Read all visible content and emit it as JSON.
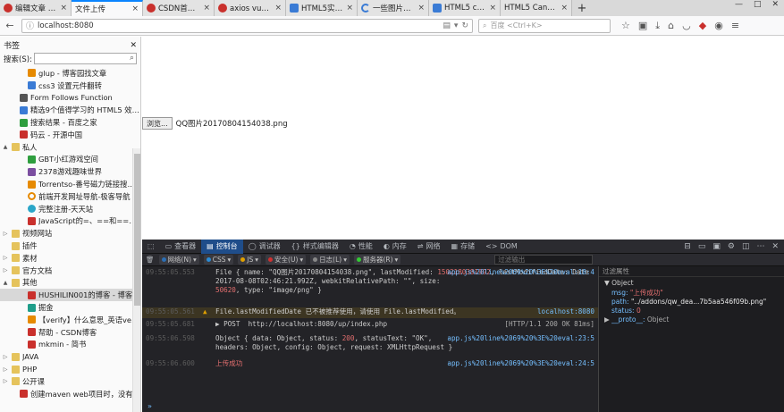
{
  "tabs": [
    {
      "label": "编辑文章 - CSD",
      "icon": "csdn-icon",
      "active": false
    },
    {
      "label": "文件上传",
      "icon": "none",
      "active": true
    },
    {
      "label": "CSDN首页-全球",
      "icon": "csdn-icon",
      "active": false
    },
    {
      "label": "axios vue 跨域",
      "icon": "csdn-icon",
      "active": false
    },
    {
      "label": "HTML5实战—",
      "icon": "page-icon",
      "active": false
    },
    {
      "label": "一些图片尺寸和",
      "icon": "loading-icon",
      "active": false
    },
    {
      "label": "HTML5 canvas",
      "icon": "page-icon",
      "active": false
    },
    {
      "label": "HTML5 Canvas",
      "icon": "none",
      "active": false
    }
  ],
  "window_controls": {
    "min": "—",
    "max": "□",
    "close": "✕"
  },
  "nav": {
    "url": "localhost:8080",
    "search_placeholder": "百度 <Ctrl+K>"
  },
  "sidebar": {
    "title": "书签",
    "search_label": "搜索(S):",
    "items": [
      {
        "label": "glup - 博客园找文章",
        "icon": "orange",
        "indent": 2,
        "twisty": ""
      },
      {
        "label": "css3 设置元件翻转",
        "icon": "blue",
        "indent": 2,
        "twisty": ""
      },
      {
        "label": "Form Follows Function",
        "icon": "dark",
        "indent": 1,
        "twisty": ""
      },
      {
        "label": "精选9个值得学习的 HTML5 效果...",
        "icon": "blue",
        "indent": 1,
        "twisty": ""
      },
      {
        "label": "搜索结果 - 百度之家",
        "icon": "green",
        "indent": 1,
        "twisty": ""
      },
      {
        "label": "码云 - 开源中国",
        "icon": "red",
        "indent": 1,
        "twisty": ""
      },
      {
        "label": "私人",
        "icon": "folder",
        "indent": 0,
        "twisty": "▲"
      },
      {
        "label": "GBT小红游戏空间",
        "icon": "green",
        "indent": 2,
        "twisty": ""
      },
      {
        "label": "2378游戏趣味世界",
        "icon": "purple",
        "indent": 2,
        "twisty": ""
      },
      {
        "label": "Torrentso-番号磁力链接搜索...",
        "icon": "orange",
        "indent": 2,
        "twisty": ""
      },
      {
        "label": "前端开发网址导航-极客导航",
        "icon": "ring",
        "indent": 2,
        "twisty": ""
      },
      {
        "label": "完整注册-天天站",
        "icon": "cyan",
        "indent": 2,
        "twisty": ""
      },
      {
        "label": "JavaScript的=、==和=== - ...",
        "icon": "red",
        "indent": 2,
        "twisty": ""
      },
      {
        "label": "视频网站",
        "icon": "folder",
        "indent": 0,
        "twisty": "▷"
      },
      {
        "label": "插件",
        "icon": "folder",
        "indent": 0,
        "twisty": ""
      },
      {
        "label": "素材",
        "icon": "folder",
        "indent": 0,
        "twisty": "▷"
      },
      {
        "label": "官方文档",
        "icon": "folder",
        "indent": 0,
        "twisty": "▷"
      },
      {
        "label": "其他",
        "icon": "folder",
        "indent": 0,
        "twisty": "▲"
      },
      {
        "label": "HUSHILIN001的博客 - 博客频...",
        "icon": "red",
        "indent": 2,
        "twisty": "",
        "selected": true
      },
      {
        "label": "掘金",
        "icon": "teal",
        "indent": 2,
        "twisty": ""
      },
      {
        "label": "【verify】什么意思_英语verify...",
        "icon": "orange",
        "indent": 2,
        "twisty": ""
      },
      {
        "label": "帮助 - CSDN博客",
        "icon": "red",
        "indent": 2,
        "twisty": ""
      },
      {
        "label": "mkmin - 简书",
        "icon": "red",
        "indent": 2,
        "twisty": ""
      },
      {
        "label": "JAVA",
        "icon": "folder",
        "indent": 0,
        "twisty": "▷"
      },
      {
        "label": "PHP",
        "icon": "folder",
        "indent": 0,
        "twisty": "▷"
      },
      {
        "label": "公开课",
        "icon": "folder",
        "indent": 0,
        "twisty": "▷"
      },
      {
        "label": "创建maven web项目时，没有we...",
        "icon": "red",
        "indent": 1,
        "twisty": ""
      }
    ]
  },
  "page": {
    "browse_label": "浏览...",
    "file_name": "QQ图片20170804154038.png"
  },
  "devtools": {
    "tabs": [
      {
        "label": "查看器",
        "icon": "inspector-icon"
      },
      {
        "label": "控制台",
        "icon": "console-icon",
        "active": true
      },
      {
        "label": "调试器",
        "icon": "debugger-icon"
      },
      {
        "label": "样式编辑器",
        "icon": "style-editor-icon"
      },
      {
        "label": "性能",
        "icon": "performance-icon"
      },
      {
        "label": "内存",
        "icon": "memory-icon"
      },
      {
        "label": "网络",
        "icon": "network-icon"
      },
      {
        "label": "存储",
        "icon": "storage-icon"
      },
      {
        "label": "DOM",
        "icon": "dom-icon"
      }
    ],
    "filters": [
      {
        "label": "网络(N)",
        "color": "#2b6fb5"
      },
      {
        "label": "CSS",
        "color": "#2b8cd6"
      },
      {
        "label": "JS",
        "color": "#e0a000"
      },
      {
        "label": "安全(U)",
        "color": "#d03030"
      },
      {
        "label": "日志(L)",
        "color": "#888"
      },
      {
        "label": "服务器(R)",
        "color": "#3c3"
      }
    ],
    "filter_placeholder": "过滤输出",
    "vars_placeholder": "过滤属性",
    "logs": {
      "l1_ts": "09:55:05.553",
      "l1_a": "File { name: \"QQ图片20170804154038.png\", lastModified: ",
      "l1_b": "1502180381992",
      "l1_c": ", lastModifiedDate: Date",
      "l1_d": "2017-08-08T02:46:21.992Z, webkitRelativePath: \"\", size:",
      "l1_e": "50620",
      "l1_f": ", type: \"image/png\" }",
      "l1_src": "app.js%20line%2069%20%3E%20eval:18:4",
      "l2_ts": "09:55:05.561",
      "l2_msg": "File.lastModifiedDate 已不被推荐使用，请使用 File.lastModified。",
      "l2_src": "localhost:8080",
      "l3_ts": "09:55:05.681",
      "l3_msg": "▶ POST  http://localhost:8080/up/index.php",
      "l3_src": "[HTTP/1.1 200 OK 81ms]",
      "l4_ts": "09:55:06.598",
      "l4_a": "Object { data: Object, status: ",
      "l4_b": "200",
      "l4_c": ", statusText: \"OK\",",
      "l4_d": "headers: Object, config: Object, request: XMLHttpRequest }",
      "l4_src": "app.js%20line%2069%20%3E%20eval:23:5",
      "l5_ts": "09:55:06.600",
      "l5_msg": "上传成功",
      "l5_src": "app.js%20line%2069%20%3E%20eval:24:5"
    },
    "vars": {
      "title": "Object",
      "msg_key": "msg:",
      "msg_val": "\"上传成功\"",
      "path_key": "path:",
      "path_val": "\"../addons/qw_dea...7b5aa546f09b.png\"",
      "status_key": "status:",
      "status_val": "0",
      "proto_key": "__proto__:",
      "proto_val": "Object"
    }
  }
}
